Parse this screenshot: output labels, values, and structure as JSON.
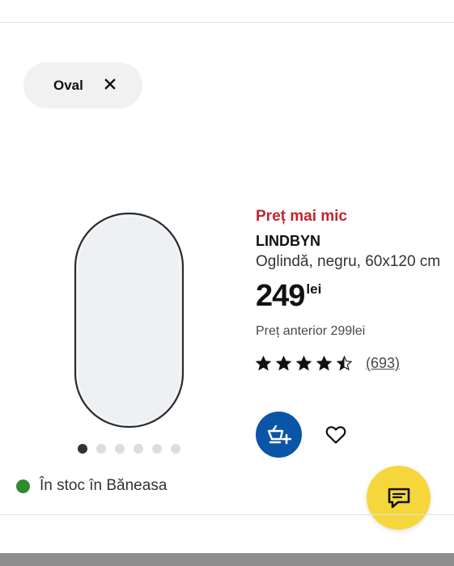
{
  "filter": {
    "label": "Oval"
  },
  "product": {
    "promo_label": "Preț mai mic",
    "name": "LINDBYN",
    "description": "Oglindă, negru, 60x120 cm",
    "price": "249",
    "currency": "lei",
    "previous_price": "Preț anterior 299lei",
    "rating": 4.5,
    "review_count": "(693)",
    "image_count": 6,
    "active_image": 1
  },
  "availability": {
    "text": "În stoc în Băneasa",
    "status_color": "#2e8b2e"
  },
  "colors": {
    "accent_blue": "#0a55a8",
    "chat_yellow": "#f5d73b",
    "promo_red": "#c0262d"
  },
  "icons": {
    "filter_close": "close-icon",
    "cart": "add-to-cart-icon",
    "favourite": "heart-icon",
    "chat": "chat-icon",
    "rating": "star-icon"
  }
}
